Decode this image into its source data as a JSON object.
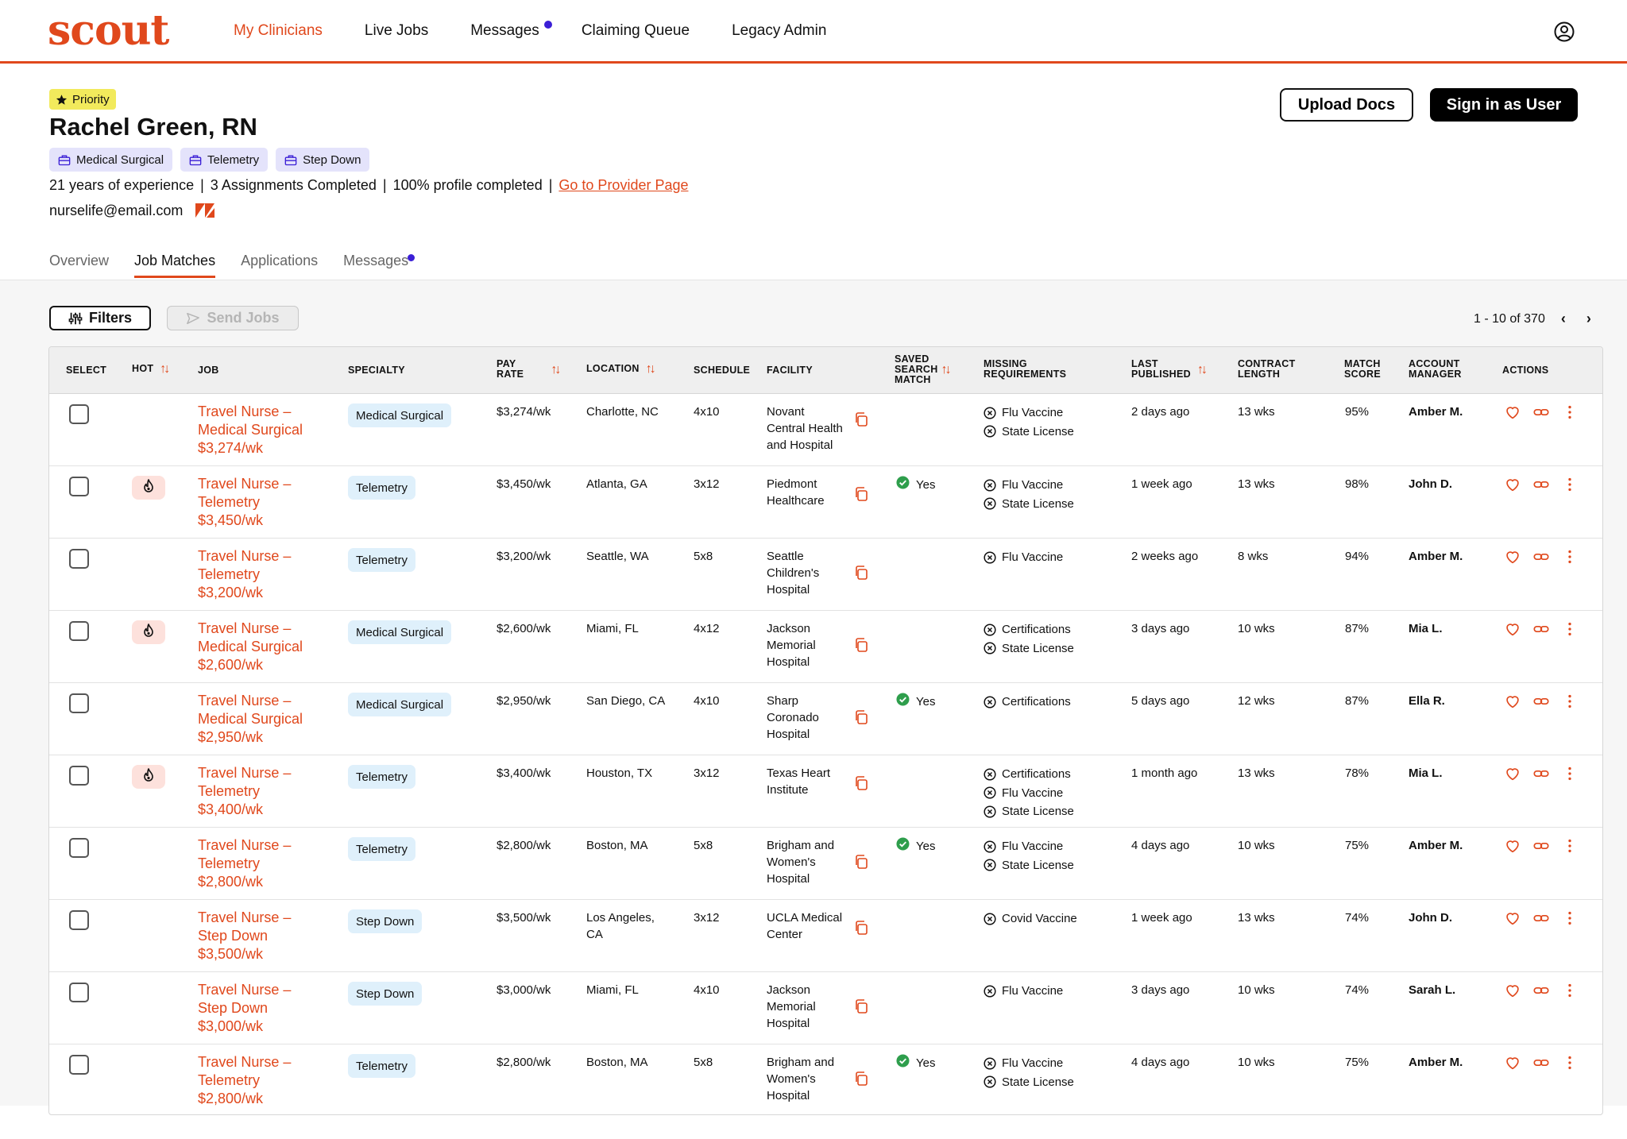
{
  "app": {
    "logo": "scout",
    "nav": [
      "My Clinicians",
      "Live Jobs",
      "Messages",
      "Claiming Queue",
      "Legacy Admin"
    ]
  },
  "clinician": {
    "priority": "Priority",
    "name": "Rachel Green, RN",
    "specialties": [
      "Medical Surgical",
      "Telemetry",
      "Step Down"
    ],
    "experience": "21 years of experience",
    "assignments": "3 Assignments Completed",
    "profile": "100% profile completed",
    "provider_link": "Go to Provider Page",
    "email": "nurselife@email.com"
  },
  "actions": {
    "upload_docs": "Upload Docs",
    "sign_in_as_user": "Sign in as User"
  },
  "tabs": [
    "Overview",
    "Job Matches",
    "Applications",
    "Messages"
  ],
  "toolbar": {
    "filters": "Filters",
    "send_jobs": "Send Jobs",
    "pagination": "1 - 10 of 370"
  },
  "columns": {
    "select": "SELECT",
    "hot": "HOT",
    "job": "JOB",
    "specialty": "SPECIALTY",
    "pay_rate_1": "PAY",
    "pay_rate_2": "RATE",
    "location": "LOCATION",
    "schedule": "SCHEDULE",
    "facility": "FACILITY",
    "saved_1": "SAVED",
    "saved_2": "SEARCH",
    "saved_3": "MATCH",
    "missing_1": "MISSING",
    "missing_2": "REQUIREMENTS",
    "last_1": "LAST",
    "last_2": "PUBLISHED",
    "contract_1": "CONTRACT",
    "contract_2": "LENGTH",
    "match_1": "MATCH",
    "match_2": "SCORE",
    "am_1": "ACCOUNT",
    "am_2": "MANAGER",
    "actions": "ACTIONS"
  },
  "rows": [
    {
      "hot": false,
      "job": [
        "Travel Nurse –",
        "Medical Surgical",
        "$3,274/wk"
      ],
      "specialty": "Medical Surgical",
      "pay": "$3,274/wk",
      "location": [
        "Charlotte, NC"
      ],
      "schedule": "4x10",
      "facility": [
        "Novant",
        "Central Health",
        "and Hospital"
      ],
      "saved": "",
      "missing": [
        "Flu Vaccine",
        "State License"
      ],
      "published": "2 days ago",
      "contract": "13 wks",
      "score": "95%",
      "manager": "Amber M."
    },
    {
      "hot": true,
      "job": [
        "Travel Nurse –",
        "Telemetry",
        "$3,450/wk"
      ],
      "specialty": "Telemetry",
      "pay": "$3,450/wk",
      "location": [
        "Atlanta, GA"
      ],
      "schedule": "3x12",
      "facility": [
        "Piedmont",
        "Healthcare"
      ],
      "saved": "Yes",
      "missing": [
        "Flu Vaccine",
        "State License"
      ],
      "published": "1 week ago",
      "contract": "13 wks",
      "score": "98%",
      "manager": "John D."
    },
    {
      "hot": false,
      "job": [
        "Travel Nurse –",
        "Telemetry",
        "$3,200/wk"
      ],
      "specialty": "Telemetry",
      "pay": "$3,200/wk",
      "location": [
        "Seattle, WA"
      ],
      "schedule": "5x8",
      "facility": [
        "Seattle",
        "Children's",
        "Hospital"
      ],
      "saved": "",
      "missing": [
        "Flu Vaccine"
      ],
      "published": "2 weeks ago",
      "contract": "8 wks",
      "score": "94%",
      "manager": "Amber M."
    },
    {
      "hot": true,
      "job": [
        "Travel Nurse –",
        "Medical Surgical",
        "$2,600/wk"
      ],
      "specialty": "Medical Surgical",
      "pay": "$2,600/wk",
      "location": [
        "Miami, FL"
      ],
      "schedule": "4x12",
      "facility": [
        "Jackson",
        "Memorial",
        "Hospital"
      ],
      "saved": "",
      "missing": [
        "Certifications",
        "State License"
      ],
      "published": "3 days ago",
      "contract": "10 wks",
      "score": "87%",
      "manager": "Mia L."
    },
    {
      "hot": false,
      "job": [
        "Travel Nurse –",
        "Medical Surgical",
        "$2,950/wk"
      ],
      "specialty": "Medical Surgical",
      "pay": "$2,950/wk",
      "location": [
        "San Diego, CA"
      ],
      "schedule": "4x10",
      "facility": [
        "Sharp",
        "Coronado",
        "Hospital"
      ],
      "saved": "Yes",
      "missing": [
        "Certifications"
      ],
      "published": "5 days ago",
      "contract": "12 wks",
      "score": "87%",
      "manager": "Ella R."
    },
    {
      "hot": true,
      "job": [
        "Travel Nurse –",
        "Telemetry",
        "$3,400/wk"
      ],
      "specialty": "Telemetry",
      "pay": "$3,400/wk",
      "location": [
        "Houston, TX"
      ],
      "schedule": "3x12",
      "facility": [
        "Texas Heart",
        "Institute"
      ],
      "saved": "",
      "missing": [
        "Certifications",
        "Flu Vaccine",
        "State License"
      ],
      "published": "1 month ago",
      "contract": "13 wks",
      "score": "78%",
      "manager": "Mia L."
    },
    {
      "hot": false,
      "job": [
        "Travel Nurse –",
        "Telemetry",
        "$2,800/wk"
      ],
      "specialty": "Telemetry",
      "pay": "$2,800/wk",
      "location": [
        "Boston, MA"
      ],
      "schedule": "5x8",
      "facility": [
        "Brigham and",
        "Women's",
        "Hospital"
      ],
      "saved": "Yes",
      "missing": [
        "Flu Vaccine",
        "State License"
      ],
      "published": "4 days ago",
      "contract": "10 wks",
      "score": "75%",
      "manager": "Amber M."
    },
    {
      "hot": false,
      "job": [
        "Travel Nurse –",
        "Step Down",
        "$3,500/wk"
      ],
      "specialty": "Step Down",
      "pay": "$3,500/wk",
      "location": [
        "Los Angeles,",
        "CA"
      ],
      "schedule": "3x12",
      "facility": [
        "UCLA Medical",
        "Center"
      ],
      "saved": "",
      "missing": [
        "Covid Vaccine"
      ],
      "published": "1 week ago",
      "contract": "13 wks",
      "score": "74%",
      "manager": "John D."
    },
    {
      "hot": false,
      "job": [
        "Travel Nurse –",
        "Step Down",
        "$3,000/wk"
      ],
      "specialty": "Step Down",
      "pay": "$3,000/wk",
      "location": [
        "Miami, FL"
      ],
      "schedule": "4x10",
      "facility": [
        "Jackson",
        "Memorial",
        "Hospital"
      ],
      "saved": "",
      "missing": [
        "Flu Vaccine"
      ],
      "published": "3 days ago",
      "contract": "10 wks",
      "score": "74%",
      "manager": "Sarah L."
    },
    {
      "hot": false,
      "job": [
        "Travel Nurse –",
        "Telemetry",
        "$2,800/wk"
      ],
      "specialty": "Telemetry",
      "pay": "$2,800/wk",
      "location": [
        "Boston, MA"
      ],
      "schedule": "5x8",
      "facility": [
        "Brigham and",
        "Women's",
        "Hospital"
      ],
      "saved": "Yes",
      "missing": [
        "Flu Vaccine",
        "State License"
      ],
      "published": "4 days ago",
      "contract": "10 wks",
      "score": "75%",
      "manager": "Amber M."
    }
  ]
}
